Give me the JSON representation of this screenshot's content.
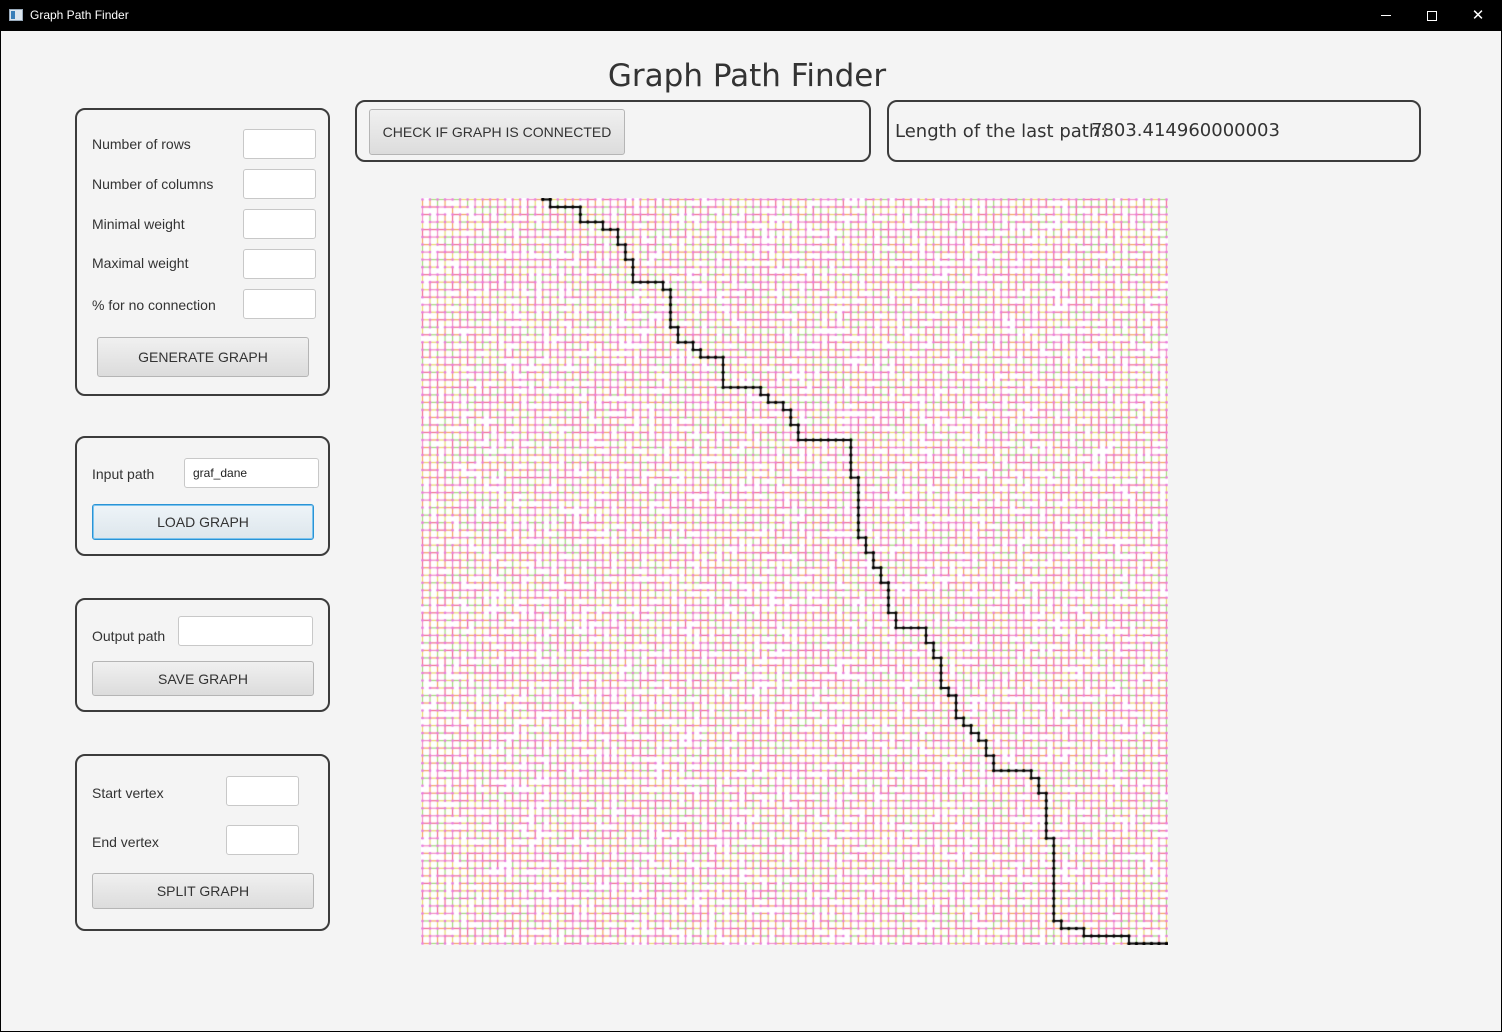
{
  "window": {
    "title": "Graph Path Finder",
    "controls": {
      "minimize": "—",
      "maximize": "□",
      "close": "✕"
    }
  },
  "heading": "Graph Path Finder",
  "generate_panel": {
    "rows_label": "Number of rows",
    "rows_value": "",
    "columns_label": "Number of columns",
    "columns_value": "",
    "min_weight_label": "Minimal weight",
    "min_weight_value": "",
    "max_weight_label": "Maximal weight",
    "max_weight_value": "",
    "no_connection_label": "% for no connection",
    "no_connection_value": "",
    "generate_button": "GENERATE GRAPH"
  },
  "load_panel": {
    "input_label": "Input path",
    "input_value": "graf_dane",
    "load_button": "LOAD GRAPH"
  },
  "save_panel": {
    "output_label": "Output path",
    "output_value": "",
    "save_button": "SAVE GRAPH"
  },
  "split_panel": {
    "start_label": "Start vertex",
    "start_value": "",
    "end_label": "End vertex",
    "end_value": "",
    "split_button": "SPLIT GRAPH"
  },
  "connect_panel": {
    "check_button": "CHECK IF GRAPH IS CONNECTED"
  },
  "length_panel": {
    "label": "Length of the last path:",
    "value": "7803.414960000003"
  },
  "graph": {
    "grid_rows": 100,
    "grid_columns": 100,
    "background_color": "#ffffff",
    "vertex_color": "#e87adf",
    "edge_colors": [
      "#f06a8a",
      "#f3a35e",
      "#e9d86a",
      "#a3d977",
      "#f28cc0"
    ],
    "path_color": "#000000",
    "path_cells": [
      [
        0,
        16
      ],
      [
        0,
        17
      ],
      [
        1,
        17
      ],
      [
        1,
        18
      ],
      [
        1,
        19
      ],
      [
        1,
        20
      ],
      [
        1,
        21
      ],
      [
        2,
        21
      ],
      [
        3,
        21
      ],
      [
        3,
        22
      ],
      [
        3,
        23
      ],
      [
        3,
        24
      ],
      [
        4,
        24
      ],
      [
        4,
        25
      ],
      [
        4,
        26
      ],
      [
        5,
        26
      ],
      [
        6,
        26
      ],
      [
        6,
        27
      ],
      [
        7,
        27
      ],
      [
        8,
        27
      ],
      [
        8,
        28
      ],
      [
        9,
        28
      ],
      [
        10,
        28
      ],
      [
        11,
        28
      ],
      [
        11,
        29
      ],
      [
        11,
        30
      ],
      [
        11,
        31
      ],
      [
        11,
        32
      ],
      [
        12,
        32
      ],
      [
        12,
        33
      ],
      [
        13,
        33
      ],
      [
        14,
        33
      ],
      [
        15,
        33
      ],
      [
        16,
        33
      ],
      [
        17,
        33
      ],
      [
        17,
        34
      ],
      [
        18,
        34
      ],
      [
        19,
        34
      ],
      [
        19,
        35
      ],
      [
        19,
        36
      ],
      [
        20,
        36
      ],
      [
        20,
        37
      ],
      [
        21,
        37
      ],
      [
        21,
        38
      ],
      [
        21,
        39
      ],
      [
        21,
        40
      ],
      [
        22,
        40
      ],
      [
        23,
        40
      ],
      [
        24,
        40
      ],
      [
        25,
        40
      ],
      [
        25,
        41
      ],
      [
        25,
        42
      ],
      [
        25,
        43
      ],
      [
        25,
        44
      ],
      [
        25,
        45
      ],
      [
        26,
        45
      ],
      [
        26,
        46
      ],
      [
        27,
        46
      ],
      [
        27,
        47
      ],
      [
        27,
        48
      ],
      [
        28,
        48
      ],
      [
        28,
        49
      ],
      [
        29,
        49
      ],
      [
        30,
        49
      ],
      [
        30,
        50
      ],
      [
        31,
        50
      ],
      [
        32,
        50
      ],
      [
        32,
        51
      ],
      [
        32,
        52
      ],
      [
        32,
        53
      ],
      [
        32,
        54
      ],
      [
        32,
        55
      ],
      [
        32,
        56
      ],
      [
        32,
        57
      ],
      [
        33,
        57
      ],
      [
        34,
        57
      ],
      [
        35,
        57
      ],
      [
        36,
        57
      ],
      [
        37,
        57
      ],
      [
        37,
        58
      ],
      [
        38,
        58
      ],
      [
        39,
        58
      ],
      [
        40,
        58
      ],
      [
        41,
        58
      ],
      [
        42,
        58
      ],
      [
        43,
        58
      ],
      [
        44,
        58
      ],
      [
        45,
        58
      ],
      [
        45,
        59
      ],
      [
        46,
        59
      ],
      [
        47,
        59
      ],
      [
        47,
        60
      ],
      [
        48,
        60
      ],
      [
        49,
        60
      ],
      [
        49,
        61
      ],
      [
        50,
        61
      ],
      [
        51,
        61
      ],
      [
        51,
        62
      ],
      [
        52,
        62
      ],
      [
        53,
        62
      ],
      [
        54,
        62
      ],
      [
        55,
        62
      ],
      [
        55,
        63
      ],
      [
        56,
        63
      ],
      [
        57,
        63
      ],
      [
        57,
        64
      ],
      [
        57,
        65
      ],
      [
        57,
        66
      ],
      [
        57,
        67
      ],
      [
        58,
        67
      ],
      [
        59,
        67
      ],
      [
        59,
        68
      ],
      [
        60,
        68
      ],
      [
        61,
        68
      ],
      [
        61,
        69
      ],
      [
        62,
        69
      ],
      [
        63,
        69
      ],
      [
        64,
        69
      ],
      [
        65,
        69
      ],
      [
        65,
        70
      ],
      [
        66,
        70
      ],
      [
        66,
        71
      ],
      [
        67,
        71
      ],
      [
        68,
        71
      ],
      [
        69,
        71
      ],
      [
        69,
        72
      ],
      [
        70,
        72
      ],
      [
        70,
        73
      ],
      [
        71,
        73
      ],
      [
        71,
        74
      ],
      [
        72,
        74
      ],
      [
        72,
        75
      ],
      [
        73,
        75
      ],
      [
        74,
        75
      ],
      [
        74,
        76
      ],
      [
        75,
        76
      ],
      [
        76,
        76
      ],
      [
        76,
        77
      ],
      [
        76,
        78
      ],
      [
        76,
        79
      ],
      [
        76,
        80
      ],
      [
        76,
        81
      ],
      [
        77,
        81
      ],
      [
        77,
        82
      ],
      [
        78,
        82
      ],
      [
        79,
        82
      ],
      [
        79,
        83
      ],
      [
        80,
        83
      ],
      [
        81,
        83
      ],
      [
        82,
        83
      ],
      [
        83,
        83
      ],
      [
        84,
        83
      ],
      [
        85,
        83
      ],
      [
        85,
        84
      ],
      [
        86,
        84
      ],
      [
        87,
        84
      ],
      [
        88,
        84
      ],
      [
        89,
        84
      ],
      [
        90,
        84
      ],
      [
        91,
        84
      ],
      [
        92,
        84
      ],
      [
        93,
        84
      ],
      [
        94,
        84
      ],
      [
        95,
        84
      ],
      [
        96,
        84
      ],
      [
        96,
        85
      ],
      [
        97,
        85
      ],
      [
        97,
        86
      ],
      [
        97,
        87
      ],
      [
        97,
        88
      ],
      [
        98,
        88
      ],
      [
        98,
        89
      ],
      [
        98,
        90
      ],
      [
        98,
        91
      ],
      [
        98,
        92
      ],
      [
        98,
        93
      ],
      [
        98,
        94
      ],
      [
        99,
        94
      ],
      [
        99,
        95
      ],
      [
        99,
        96
      ],
      [
        99,
        97
      ],
      [
        99,
        98
      ],
      [
        99,
        99
      ]
    ]
  }
}
